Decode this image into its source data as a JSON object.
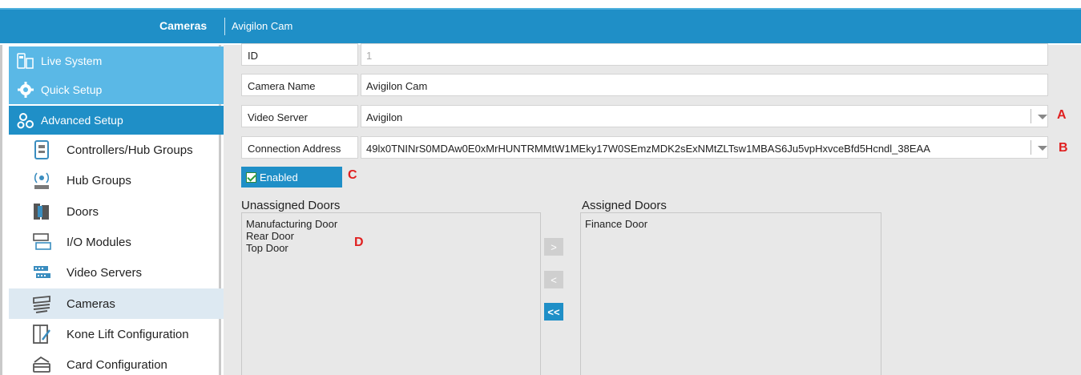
{
  "header": {
    "section": "Cameras",
    "current": "Avigilon Cam"
  },
  "sidebar": {
    "top": [
      {
        "label": "Live System"
      },
      {
        "label": "Quick Setup"
      },
      {
        "label": "Advanced Setup"
      }
    ],
    "items": [
      {
        "label": "Controllers/Hub Groups"
      },
      {
        "label": "Hub Groups"
      },
      {
        "label": "Doors"
      },
      {
        "label": "I/O Modules"
      },
      {
        "label": "Video Servers"
      },
      {
        "label": "Cameras"
      },
      {
        "label": "Kone Lift Configuration"
      },
      {
        "label": "Card Configuration"
      }
    ]
  },
  "form": {
    "id": {
      "label": "ID",
      "value": "1"
    },
    "camera_name": {
      "label": "Camera Name",
      "value": "Avigilon Cam"
    },
    "video_server": {
      "label": "Video Server",
      "value": "Avigilon"
    },
    "connection_address": {
      "label": "Connection Address",
      "value": "49lx0TNINrS0MDAw0E0xMrHUNTRMMtW1MEky17W0SEmzMDK2sExNMtZLTsw1MBAS6Ju5vpHxvceBfd5Hcndl_38EAA"
    },
    "enabled_label": "Enabled"
  },
  "markers": {
    "a": "A",
    "b": "B",
    "c": "C",
    "d": "D"
  },
  "unassigned": {
    "title": "Unassigned Doors",
    "items": [
      "Manufacturing Door",
      "Rear Door",
      "Top Door"
    ]
  },
  "assigned": {
    "title": "Assigned Doors",
    "items": [
      "Finance Door"
    ]
  },
  "buttons": {
    "assign": ">",
    "unassign": "<",
    "unassign_all": "<<"
  },
  "colors": {
    "accent": "#1f8fc7",
    "accent_light": "#5ab8e6",
    "marker": "#e02020"
  }
}
